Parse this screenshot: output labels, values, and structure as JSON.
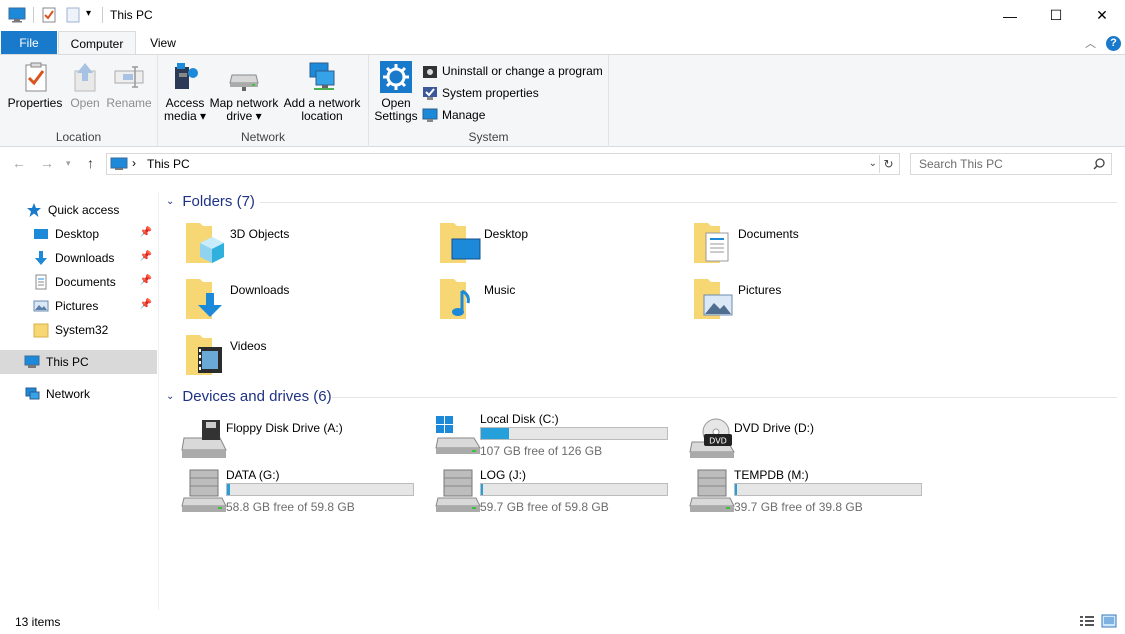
{
  "window": {
    "title": "This PC",
    "minimize_label": "—",
    "maximize_label": "☐",
    "close_label": "✕"
  },
  "tabs": {
    "file": "File",
    "computer": "Computer",
    "view": "View",
    "help": "?"
  },
  "ribbon": {
    "location": {
      "label": "Location",
      "properties": "Properties",
      "open": "Open",
      "rename": "Rename"
    },
    "network": {
      "label": "Network",
      "access_media_1": "Access",
      "access_media_2": "media ▾",
      "map_drive_1": "Map network",
      "map_drive_2": "drive ▾",
      "add_location_1": "Add a network",
      "add_location_2": "location"
    },
    "system": {
      "label": "System",
      "open_settings_1": "Open",
      "open_settings_2": "Settings",
      "uninstall": "Uninstall or change a program",
      "system_properties": "System properties",
      "manage": "Manage"
    }
  },
  "address": {
    "path": "This PC",
    "separator": "›",
    "search_placeholder": "Search This PC"
  },
  "navpane": {
    "quick_access": "Quick access",
    "items": [
      {
        "label": "Desktop",
        "pinned": true
      },
      {
        "label": "Downloads",
        "pinned": true
      },
      {
        "label": "Documents",
        "pinned": true
      },
      {
        "label": "Pictures",
        "pinned": true
      },
      {
        "label": "System32",
        "pinned": false
      }
    ],
    "this_pc": "This PC",
    "network": "Network"
  },
  "folders": {
    "header": "Folders (7)",
    "items": [
      "3D Objects",
      "Desktop",
      "Documents",
      "Downloads",
      "Music",
      "Pictures",
      "Videos"
    ]
  },
  "drives": {
    "header": "Devices and drives (6)",
    "items": [
      {
        "name": "Floppy Disk Drive (A:)",
        "free": "",
        "used_fraction": null
      },
      {
        "name": "Local Disk (C:)",
        "free": "107 GB free of 126 GB",
        "used_fraction": 0.15
      },
      {
        "name": "DVD Drive (D:)",
        "free": "",
        "used_fraction": null
      },
      {
        "name": "DATA (G:)",
        "free": "58.8 GB free of 59.8 GB",
        "used_fraction": 0.017
      },
      {
        "name": "LOG (J:)",
        "free": "59.7 GB free of 59.8 GB",
        "used_fraction": 0.002
      },
      {
        "name": "TEMPDB (M:)",
        "free": "39.7 GB free of 39.8 GB",
        "used_fraction": 0.003
      }
    ]
  },
  "status": {
    "items_count": "13 items"
  },
  "colors": {
    "accent": "#1979ca",
    "drive_bar": "#26a0da",
    "section_header": "#1e3287",
    "folder": "#f7d674"
  }
}
